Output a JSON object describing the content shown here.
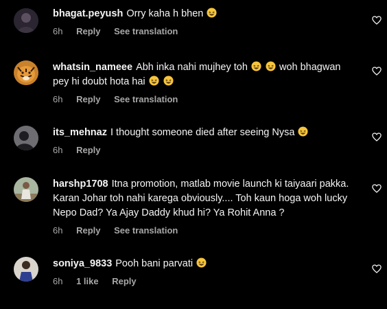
{
  "comments": [
    {
      "username": "bhagat.peyush",
      "text": "Orry kaha h bhen",
      "emojis": 1,
      "time": "6h",
      "likes": "",
      "reply_label": "Reply",
      "translation_label": "See translation",
      "avatar_icon": "profile-photo-dark",
      "liked": false
    },
    {
      "username": "whatsin_nameee",
      "text": "Abh inka nahi mujhey toh",
      "text_line2_prefix": "",
      "text_after_emojis": "woh bhagwan pey hi doubt hota hai",
      "emojis": 2,
      "emojis_end": 2,
      "time": "6h",
      "likes": "",
      "reply_label": "Reply",
      "translation_label": "See translation",
      "avatar_icon": "profile-photo-tiger",
      "liked": false
    },
    {
      "username": "its_mehnaz",
      "text": "I thought someone died after seeing Nysa",
      "emojis": 1,
      "time": "6h",
      "likes": "",
      "reply_label": "Reply",
      "translation_label": "",
      "avatar_icon": "profile-photo-silhouette",
      "liked": false
    },
    {
      "username": "harshp1708",
      "text": "Itna promotion, matlab movie launch ki taiyaari pakka. Karan Johar toh nahi karega obviously.... Toh kaun hoga woh lucky Nepo Dad? Ya Ajay Daddy khud hi? Ya Rohit Anna ?",
      "emojis": 0,
      "time": "6h",
      "likes": "",
      "reply_label": "Reply",
      "translation_label": "See translation",
      "avatar_icon": "profile-photo-outdoor",
      "liked": false
    },
    {
      "username": "soniya_9833",
      "text": "Pooh bani parvati",
      "emojis": 1,
      "time": "6h",
      "likes": "1 like",
      "reply_label": "Reply",
      "translation_label": "",
      "avatar_icon": "profile-photo-person",
      "liked": false
    }
  ],
  "colors": {
    "background": "#000000",
    "text": "#f5f5f5",
    "meta": "#a8a8a8",
    "emoji": "#f7c53c"
  },
  "icons": {
    "like": "heart-outline-icon",
    "emoji": "laughing-face-emoji"
  }
}
